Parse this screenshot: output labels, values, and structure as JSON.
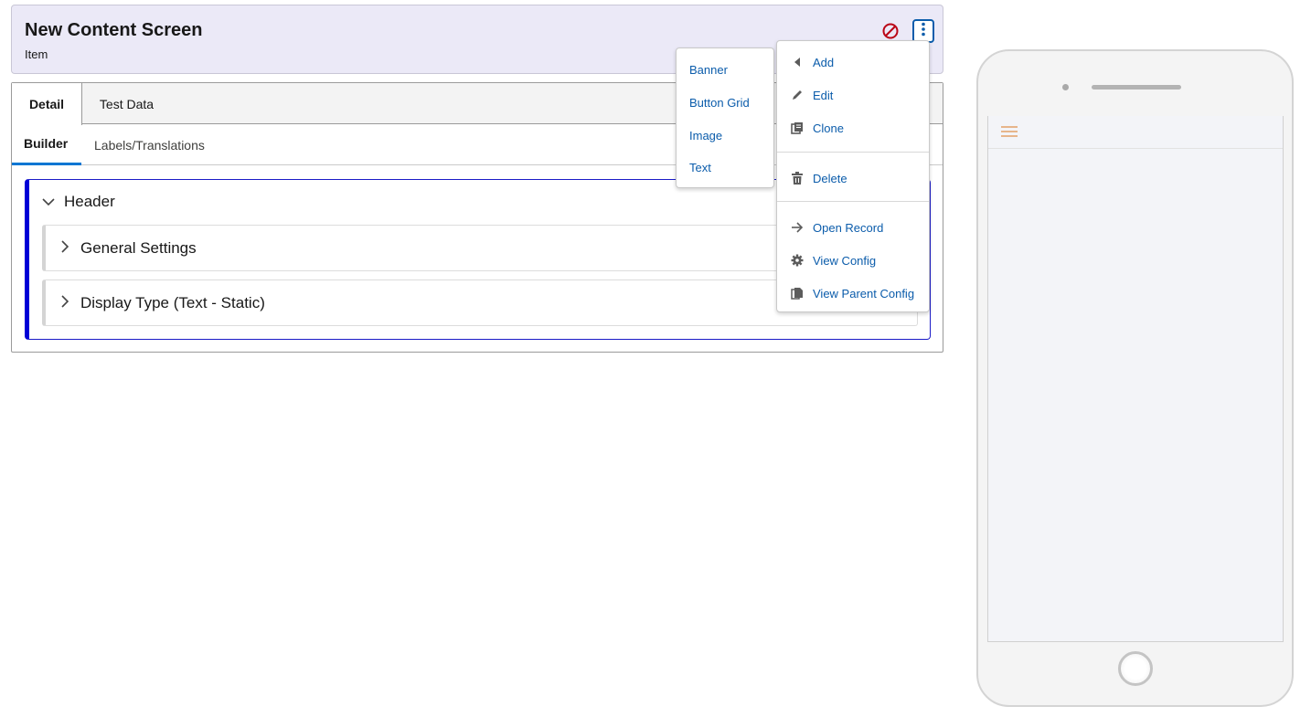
{
  "header": {
    "title": "New Content Screen",
    "subtitle": "Item",
    "block_icon": "prohibited-icon",
    "menu_icon": "kebab-menu-icon",
    "colors": {
      "background": "#ebe9f7",
      "block_icon": "#ba0517",
      "menu_border": "#0b5cab"
    }
  },
  "tabs": [
    {
      "label": "Detail",
      "active": true
    },
    {
      "label": "Test Data",
      "active": false
    }
  ],
  "subtabs": [
    {
      "label": "Builder",
      "active": true
    },
    {
      "label": "Labels/Translations",
      "active": false
    }
  ],
  "builder": {
    "section_title": "Header",
    "subsections": [
      {
        "title": "General Settings"
      },
      {
        "title": "Display Type (Text - Static)"
      }
    ]
  },
  "actions_menu": {
    "items": [
      {
        "label": "Add",
        "icon": "caret-left-icon"
      },
      {
        "label": "Edit",
        "icon": "pencil-icon"
      },
      {
        "label": "Clone",
        "icon": "copy-icon"
      },
      {
        "label": "Delete",
        "icon": "trash-icon"
      },
      {
        "label": "Open Record",
        "icon": "arrow-right-icon"
      },
      {
        "label": "View Config",
        "icon": "gear-icon"
      },
      {
        "label": "View Parent Config",
        "icon": "documents-icon"
      }
    ]
  },
  "add_submenu": {
    "items": [
      {
        "label": "Banner"
      },
      {
        "label": "Button Grid"
      },
      {
        "label": "Image"
      },
      {
        "label": "Text"
      }
    ]
  },
  "phone_preview": {
    "menu_icon": "hamburger-icon",
    "colors": {
      "hamburger": "#e7b58b",
      "screen": "#f3f4f8"
    }
  }
}
